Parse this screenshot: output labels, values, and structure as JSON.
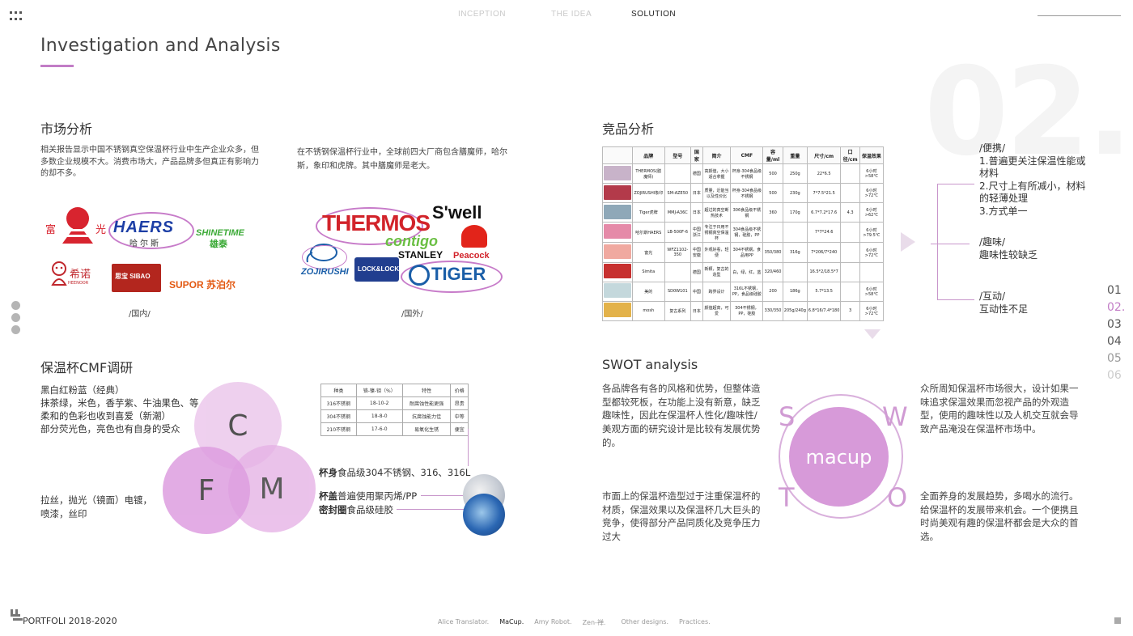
{
  "nav": {
    "items": [
      "INCEPTION",
      "THE IDEA",
      "SOLUTION"
    ],
    "active": 2
  },
  "page": {
    "title": "Investigation and Analysis",
    "big_number": "02."
  },
  "market": {
    "title": "市场分析",
    "para_domestic": "相关报告显示中国不锈钢真空保温杯行业中生产企业众多，但多数企业规模不大。消费市场大，产品品牌多但真正有影响力的却不多。",
    "para_foreign": "在不锈钢保温杯行业中，全球前四大厂商包含膳魔师，哈尔斯，象印和虎牌。其中膳魔师是老大。",
    "domestic_logos": {
      "fuguang_left": "富",
      "fuguang_right": "光",
      "haers": "HAERS",
      "haers_sub": "哈尔斯",
      "shinetime": "SHINETIME",
      "shinetime_sub": "雄泰",
      "heenoor": "希诺",
      "heenoor_sub": "HEENOOR",
      "sibao": "思宝 SIBAO",
      "supor": "SUPOR 苏泊尔"
    },
    "foreign_logos": {
      "thermos": "THERMOS",
      "swell": "S'well",
      "contigo": "contigo",
      "peacock": "Peacock",
      "stanley": "STANLEY",
      "zojirushi": "ZOJIRUSHI",
      "locklock": "LOCK&LOCK",
      "tiger": "TIGER"
    },
    "caption_domestic": "/国内/",
    "caption_foreign": "/国外/"
  },
  "competitor": {
    "title": "竞品分析",
    "headers": [
      "",
      "品牌",
      "型号",
      "国家",
      "简介",
      "CMF",
      "容量/ml",
      "重量",
      "尺寸/cm",
      "口径/cm",
      "保温效果"
    ],
    "rows": [
      {
        "swatch": "#c8b3c9",
        "brand": "THERMOS(膳魔师)",
        "model": "",
        "country": "德国",
        "intro": "高颜值，大小适合拿握",
        "cmf": "杯身-304食品级不锈钢",
        "cap": "500",
        "weight": "250g",
        "size": "22*6.5",
        "mouth": "",
        "effect": "6小时>58℃"
      },
      {
        "swatch": "#b33a4a",
        "brand": "ZOJIRUSHI象印",
        "model": "SM-AZE50",
        "country": "日本",
        "intro": "质量，近能当以及性价比",
        "cmf": "杯身-304食品级不锈钢",
        "cap": "500",
        "weight": "230g",
        "size": "7*7.5*21.5",
        "mouth": "",
        "effect": "6小时>72℃"
      },
      {
        "swatch": "#8fa8b8",
        "brand": "Tiger虎牌",
        "model": "MMJ-A36C",
        "country": "日本",
        "intro": "超过的真空断热技术",
        "cmf": "306食品级不锈钢",
        "cap": "360",
        "weight": "170g",
        "size": "6.7*7.2*17.6",
        "mouth": "4.3",
        "effect": "6小时>62℃"
      },
      {
        "swatch": "#e58aa8",
        "brand": "哈尔斯HAERS",
        "model": "LB-500F-6",
        "country": "中国浙江",
        "intro": "专注于日用不锈钢真空保温杯",
        "cmf": "304食品级不锈钢，硅胶，PP",
        "cap": "",
        "weight": "",
        "size": "7*7*24.6",
        "mouth": "",
        "effect": "6小时>79.5℃"
      },
      {
        "swatch": "#f0a9a0",
        "brand": "富光",
        "model": "WFZ1102-350",
        "country": "中国安徽",
        "intro": "外观好看，轻便",
        "cmf": "304不锈钢，食品用PP",
        "cap": "350/380",
        "weight": "316g",
        "size": "7*206/7*240",
        "mouth": "",
        "effect": "6小时>72℃"
      },
      {
        "swatch": "#c7302f",
        "brand": "Simita",
        "model": "",
        "country": "德国",
        "intro": "新颖，复古的造型",
        "cmf": "白，绿，红，蓝",
        "cap": "320/460",
        "weight": "",
        "size": "16.5*2/18.5*7",
        "mouth": "",
        "effect": ""
      },
      {
        "swatch": "#c4d8dc",
        "brand": "美的",
        "model": "SD0W101",
        "country": "中国",
        "intro": "跨界设计",
        "cmf": "316L不锈钢，PP，食品级硅胶",
        "cap": "200",
        "weight": "186g",
        "size": "5.7*13.5",
        "mouth": "",
        "effect": "6小时>58℃"
      },
      {
        "swatch": "#e3b24a",
        "brand": "mosh",
        "model": "复古系列",
        "country": "日本",
        "intro": "颜值超高，可爱",
        "cmf": "304不锈钢，PP，硅胶",
        "cap": "330/350",
        "weight": "205g/240g",
        "size": "6.8*16/7.4*180",
        "mouth": "3",
        "effect": "6小时>72℃"
      }
    ]
  },
  "summary": {
    "portable_title": "/便携/",
    "portable_lines": [
      "1.普遍更关注保温性能或材料",
      "2.尺寸上有所减小，材料的轻薄处理",
      "3.方式单一"
    ],
    "fun_title": "/趣味/",
    "fun_text": "趣味性较缺乏",
    "interact_title": "/互动/",
    "interact_text": "互动性不足"
  },
  "page_nums": [
    "01",
    "02.",
    "03",
    "04",
    "05",
    "06"
  ],
  "cmf": {
    "title": "保温杯CMF调研",
    "color_text": [
      "黑白红粉蓝（经典）",
      "抹茶绿，米色，香芋紫、牛油果色、等",
      "柔和的色彩也收到喜爱（新潮）",
      "部分荧光色，亮色也有自身的受众"
    ],
    "finish_text": [
      "拉丝，抛光（镜面）电镀，",
      "喷漆，丝印"
    ],
    "circles": {
      "c": "C",
      "f": "F",
      "m": "M"
    },
    "table_headers": [
      "种类",
      "铬-镍-钼（%）",
      "特性",
      "价格"
    ],
    "table_rows": [
      [
        "316不锈钢",
        "18-10-2",
        "耐腐蚀性能更强",
        "昂贵"
      ],
      [
        "304不锈钢",
        "18-8-0",
        "抗腐蚀能力佳",
        "中等"
      ],
      [
        "210不锈钢",
        "17-6-0",
        "易氧化生锈",
        "便宜"
      ]
    ],
    "body_label": "杯身",
    "body_text": "食品级304不锈钢、316、316L",
    "lid_label": "杯盖",
    "lid_text": "普遍使用聚丙烯/PP",
    "seal_label": "密封圈",
    "seal_text": "食品级硅胶"
  },
  "swot": {
    "title": "SWOT analysis",
    "s_text": "各品牌各有各的风格和优势，但整体造型都较死板，在功能上没有新意，缺乏趣味性，因此在保温杯人性化/趣味性/美观方面的研究设计是比较有发展优势的。",
    "w_text": "众所周知保温杯市场很大，设计如果一味追求保温效果而忽视产品的外观造型，使用的趣味性以及人机交互就会导致产品淹没在保温杯市场中。",
    "t_text": "市面上的保温杯造型过于注重保温杯的材质，保温效果以及保温杯几大巨头的竞争，使得部分产品同质化及竞争压力过大",
    "o_text": "全面养身的发展趋势，多喝水的流行。给保温杯的发展带来机会。一个便携且时尚美观有趣的保温杯都会是大众的首选。",
    "center": "macup",
    "letters": {
      "s": "S",
      "w": "W",
      "t": "T",
      "o": "O"
    }
  },
  "footer": {
    "label": "PORTFOLI 2018-2020",
    "nav": [
      "Alice Translator.",
      "MaCup.",
      "Amy Robot.",
      "Zen-禅.",
      "Other designs.",
      "Practices."
    ],
    "active": 1
  },
  "colors": {
    "accent": "#c27dc6",
    "circle_light": "#ebc9ec",
    "circle_mid": "#de9ee0"
  }
}
